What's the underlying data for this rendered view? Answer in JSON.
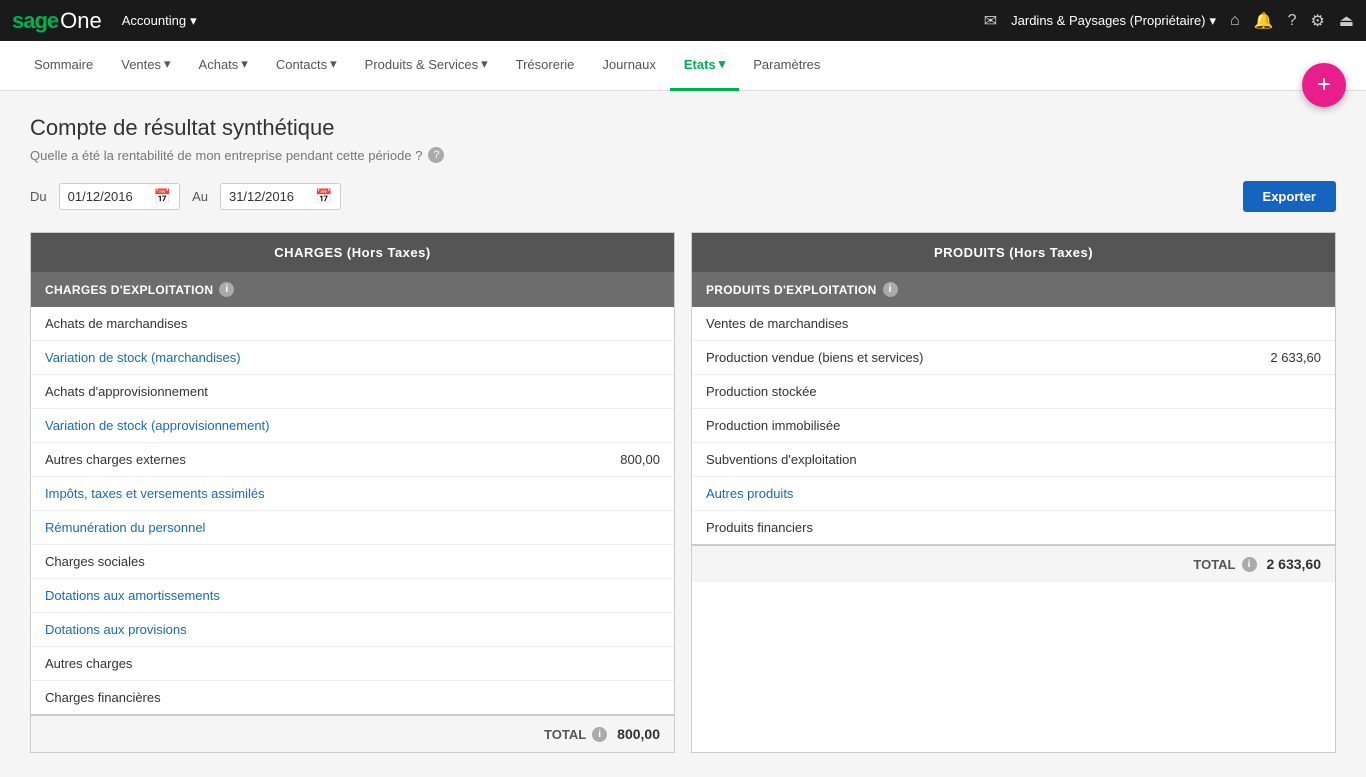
{
  "topnav": {
    "logo_sage": "sage",
    "logo_one": "One",
    "accounting_label": "Accounting",
    "dropdown_arrow": "▾",
    "company_name": "Jardins & Paysages (Propriétaire)",
    "company_arrow": "▾",
    "icons": {
      "mail": "✉",
      "home": "⌂",
      "bell": "🔔",
      "help": "?",
      "settings": "⚙",
      "logout": "⏏"
    }
  },
  "mainnav": {
    "items": [
      {
        "label": "Sommaire",
        "active": false
      },
      {
        "label": "Ventes",
        "active": false,
        "dropdown": true
      },
      {
        "label": "Achats",
        "active": false,
        "dropdown": true
      },
      {
        "label": "Contacts",
        "active": false,
        "dropdown": true
      },
      {
        "label": "Produits & Services",
        "active": false,
        "dropdown": true
      },
      {
        "label": "Trésorerie",
        "active": false
      },
      {
        "label": "Journaux",
        "active": false
      },
      {
        "label": "Etats",
        "active": true,
        "dropdown": true
      },
      {
        "label": "Paramètres",
        "active": false
      }
    ],
    "fab_label": "+"
  },
  "page": {
    "title": "Compte de résultat synthétique",
    "subtitle": "Quelle a été la rentabilité de mon entreprise pendant cette période ?",
    "from_label": "Du",
    "to_label": "Au",
    "from_date": "01/12/2016",
    "to_date": "31/12/2016",
    "export_label": "Exporter"
  },
  "charges_table": {
    "header": "CHARGES (Hors Taxes)",
    "subheader": "CHARGES D'EXPLOITATION",
    "rows": [
      {
        "label": "Achats de marchandises",
        "value": "",
        "link": false
      },
      {
        "label": "Variation de stock (marchandises)",
        "value": "",
        "link": true
      },
      {
        "label": "Achats d'approvisionnement",
        "value": "",
        "link": false
      },
      {
        "label": "Variation de stock (approvisionnement)",
        "value": "",
        "link": true
      },
      {
        "label": "Autres charges externes",
        "value": "800,00",
        "link": false
      },
      {
        "label": "Impôts, taxes et versements assimilés",
        "value": "",
        "link": true
      },
      {
        "label": "Rémunération du personnel",
        "value": "",
        "link": true
      },
      {
        "label": "Charges sociales",
        "value": "",
        "link": false
      },
      {
        "label": "Dotations aux amortissements",
        "value": "",
        "link": true
      },
      {
        "label": "Dotations aux provisions",
        "value": "",
        "link": true
      },
      {
        "label": "Autres charges",
        "value": "",
        "link": false
      },
      {
        "label": "Charges financières",
        "value": "",
        "link": false
      }
    ],
    "total_label": "TOTAL",
    "total_value": "800,00"
  },
  "produits_table": {
    "header": "PRODUITS (Hors Taxes)",
    "subheader": "PRODUITS D'EXPLOITATION",
    "rows": [
      {
        "label": "Ventes de marchandises",
        "value": "",
        "link": false
      },
      {
        "label": "Production vendue (biens et services)",
        "value": "2 633,60",
        "link": false
      },
      {
        "label": "Production stockée",
        "value": "",
        "link": false
      },
      {
        "label": "Production immobilisée",
        "value": "",
        "link": false
      },
      {
        "label": "Subventions d'exploitation",
        "value": "",
        "link": false
      },
      {
        "label": "Autres produits",
        "value": "",
        "link": true
      },
      {
        "label": "Produits financiers",
        "value": "",
        "link": false
      }
    ],
    "total_label": "TOTAL",
    "total_value": "2 633,60"
  }
}
